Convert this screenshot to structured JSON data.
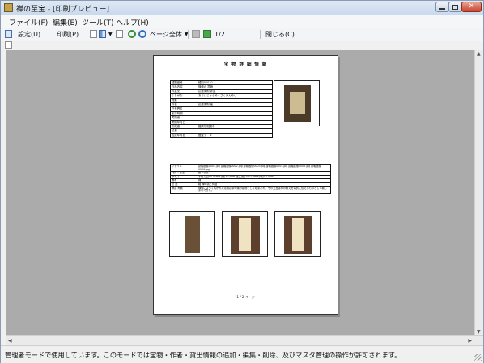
{
  "window": {
    "title": "禅の至宝 - [印刷プレビュー]",
    "close_glyph": "✕"
  },
  "menu": [
    "ファイル(F)",
    "編集(E)",
    "ツール(T)",
    "ヘルプ(H)"
  ],
  "toolbar": {
    "setup_label": "設定(U)...",
    "print_label": "印刷(P)...",
    "zoom_select": "ページ全体",
    "page_indicator": "1/2",
    "close_label": "閉じる(C)"
  },
  "preview": {
    "title": "宝 物 詳 細 情 報",
    "fields": [
      {
        "label": "種類番号",
        "value": "種別00010"
      },
      {
        "label": "作品内容",
        "value": "禅僧の 墨蹟"
      },
      {
        "label": "作品名",
        "value": "伝達清則 作品"
      },
      {
        "label": "ふりがな",
        "value": "あおいじゅうそくさくひんめい"
      },
      {
        "label": "員数",
        "value": ""
      },
      {
        "label": "作者",
        "value": "伝達清則 他"
      },
      {
        "label": "作者異名",
        "value": ""
      },
      {
        "label": "制作時期",
        "value": ""
      },
      {
        "label": "寄贈者",
        "value": ""
      },
      {
        "label": "寄贈年月日",
        "value": ""
      },
      {
        "label": "所蔵者",
        "value": "臨済宗相国寺"
      },
      {
        "label": "法量",
        "value": ""
      },
      {
        "label": "指定年月名",
        "value": "国宝データ"
      }
    ],
    "fields_long": [
      {
        "label": "ファイル",
        "value": "掛軸画像0001.jpg 掛軸画像0002.jpg 掛軸画像0003.jpg 掛軸画像0004.jpg 掛軸画像0005.jpg 掛軸画像0006.jpg"
      },
      {
        "label": "材質・技法",
        "value": "紙本墨書"
      },
      {
        "label": "サイズ",
        "value": "本紙 (縦)80.0cm×(横)30.5cm 総丈(縦)180.0cm×(横)42.0cm"
      },
      {
        "label": "備考",
        "value": "補"
      },
      {
        "label": "法 語",
        "value": "箱 禅の書と禅語"
      },
      {
        "label": "解説 考察",
        "value": "禅僧によって書かれた墨蹟は茶の湯の掛物として珍重され、その文言は禅の教えを端的に伝えるものとして親しまれてきた。"
      }
    ],
    "footer": "1 / 2 ページ"
  },
  "status_text": "管理者モードで使用しています。このモードでは宝物・作者・貸出情報の追加・編集・削除、及びマスタ管理の操作が許可されます。"
}
